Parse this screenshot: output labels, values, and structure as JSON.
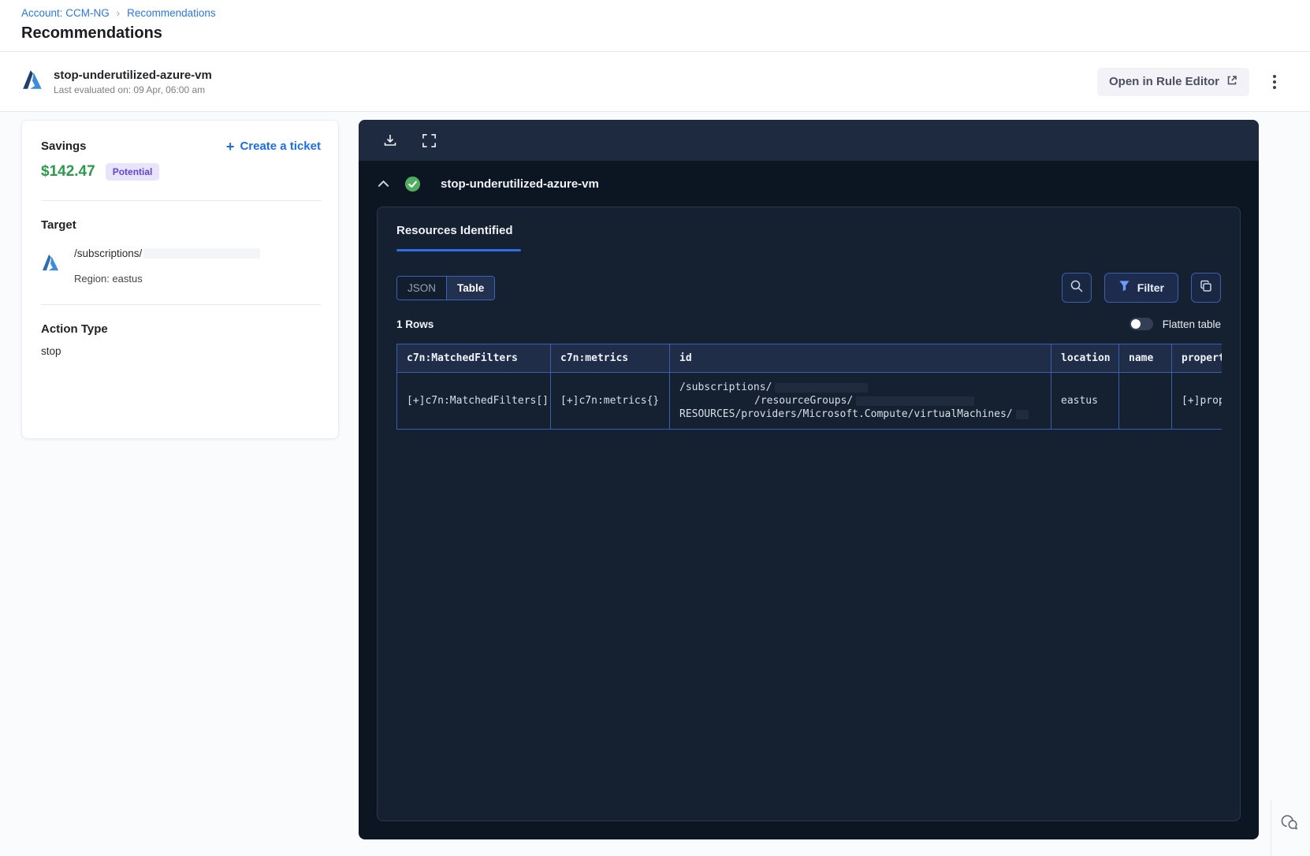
{
  "breadcrumb": {
    "account_label": "Account: CCM-NG",
    "separator": "›",
    "page_label": "Recommendations"
  },
  "page_title": "Recommendations",
  "recommendation_header": {
    "name": "stop-underutilized-azure-vm",
    "last_evaluated": "Last evaluated on: 09 Apr, 06:00 am",
    "open_rule_editor_label": "Open in Rule Editor"
  },
  "details_card": {
    "savings_label": "Savings",
    "savings_amount": "$142.47",
    "savings_badge": "Potential",
    "create_ticket_plus": "+",
    "create_ticket_label": "Create a ticket",
    "target_label": "Target",
    "target_path": "/subscriptions/",
    "target_region": "Region: eastus",
    "action_type_label": "Action Type",
    "action_type_value": "stop"
  },
  "results_panel": {
    "section_title": "stop-underutilized-azure-vm",
    "resources_tab_label": "Resources Identified",
    "json_toggle_label": "JSON",
    "table_toggle_label": "Table",
    "filter_button_label": "Filter",
    "rows_count_label": "1 Rows",
    "flatten_table_label": "Flatten table",
    "table": {
      "columns": [
        "c7n:MatchedFilters",
        "c7n:metrics",
        "id",
        "location",
        "name",
        "propert"
      ],
      "rows": [
        {
          "matched_filters": "[+]c7n:MatchedFilters[]",
          "metrics": "[+]c7n:metrics{}",
          "id_line_1": "/subscriptions/",
          "id_line_2": "/resourceGroups/",
          "id_line_3": "RESOURCES/providers/Microsoft.Compute/virtualMachines/",
          "location": "eastus",
          "name": "",
          "properties": "[+]prop"
        }
      ]
    }
  },
  "colors": {
    "accent_blue": "#1a6fe8",
    "savings_green": "#2b9b4b",
    "badge_purple": "#5f45d8",
    "panel_border_blue": "#3a5fae",
    "success_green": "#4fae5f"
  }
}
